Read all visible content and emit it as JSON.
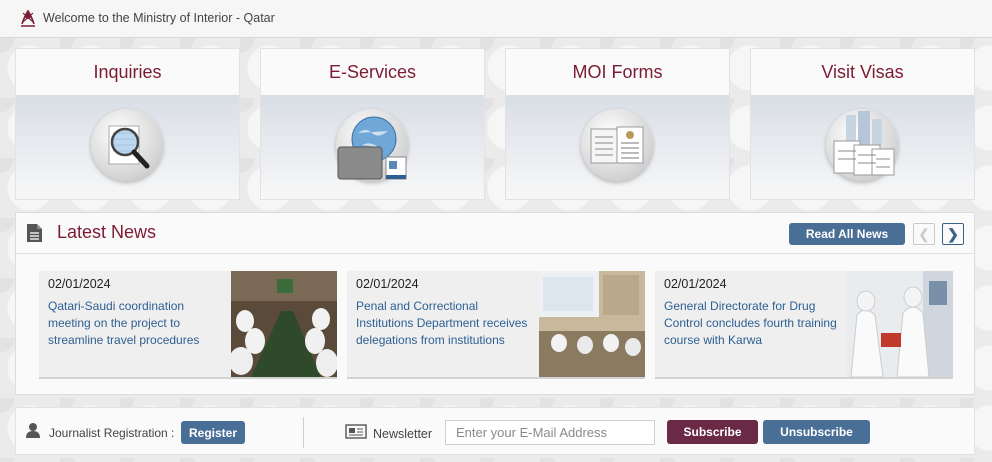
{
  "topbar": {
    "welcome_text": "Welcome to the Ministry of Interior - Qatar",
    "logo_icon": "moi-qatar-emblem-icon"
  },
  "tiles": [
    {
      "title": "Inquiries",
      "icon": "magnifier-document-icon"
    },
    {
      "title": "E-Services",
      "icon": "globe-cards-icon"
    },
    {
      "title": "MOI Forms",
      "icon": "forms-document-icon"
    },
    {
      "title": "Visit Visas",
      "icon": "visa-documents-icon"
    }
  ],
  "news": {
    "heading": "Latest News",
    "read_all_label": "Read All News",
    "prev_icon": "chevron-left-icon",
    "next_icon": "chevron-right-icon",
    "items": [
      {
        "date": "02/01/2024",
        "text": "Qatari-Saudi coordination meeting on the project to streamline travel procedures"
      },
      {
        "date": "02/01/2024",
        "text": "Penal and Correctional Institutions Department receives delegations from institutions"
      },
      {
        "date": "02/01/2024",
        "text": "General Directorate for Drug Control concludes fourth training course with Karwa"
      }
    ]
  },
  "footer": {
    "journalist_label": "Journalist Registration :",
    "register_label": "Register",
    "newsletter_label": "Newsletter",
    "email_placeholder": "Enter your E-Mail Address",
    "subscribe_label": "Subscribe",
    "unsubscribe_label": "Unsubscribe"
  },
  "colors": {
    "maroon": "#7b1c34",
    "button_blue": "#4a6f96",
    "subscribe_maroon": "#6a2a45",
    "link_blue": "#2d5f93"
  }
}
